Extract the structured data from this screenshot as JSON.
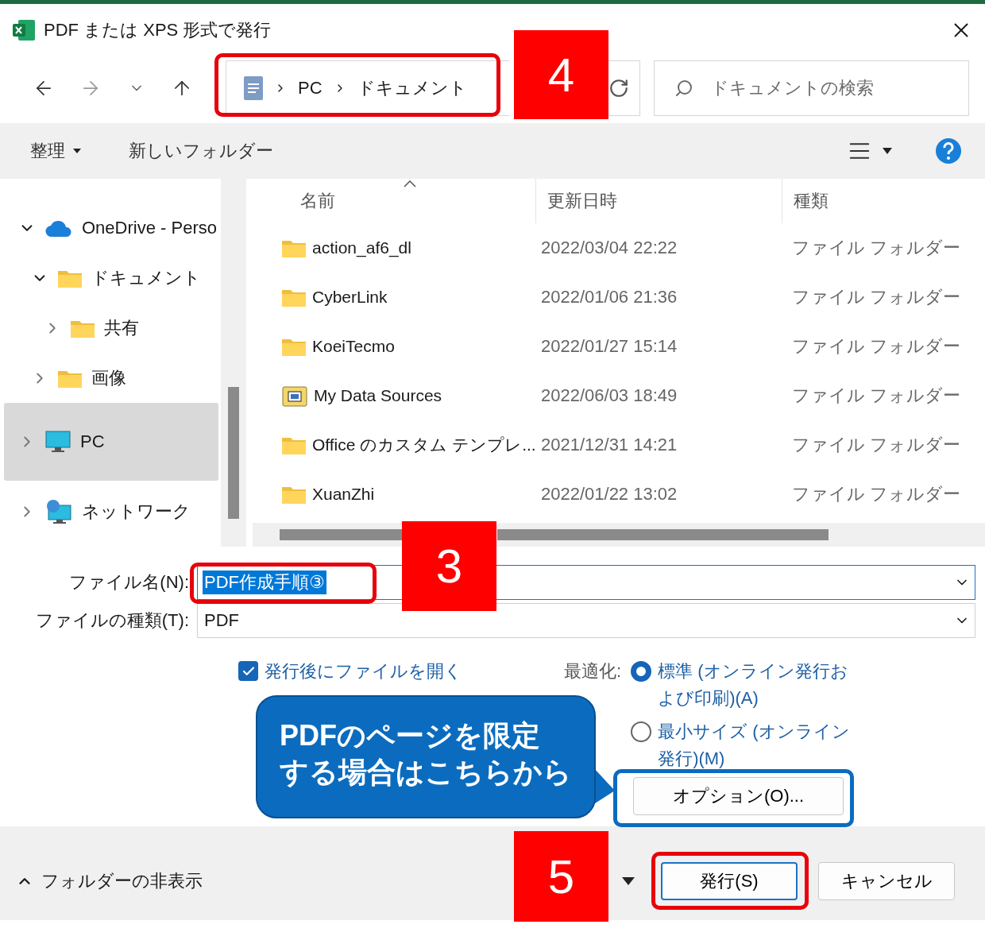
{
  "window": {
    "title": "PDF または XPS 形式で発行"
  },
  "nav": {
    "breadcrumb": [
      "PC",
      "ドキュメント"
    ],
    "search": {
      "placeholder": "ドキュメントの検索"
    }
  },
  "toolbar": {
    "organize": "整理",
    "new_folder": "新しいフォルダー"
  },
  "sidebar": {
    "items": [
      {
        "label": "OneDrive - Perso",
        "kind": "cloud",
        "expanded": true,
        "selected": false,
        "children": [
          {
            "label": "ドキュメント",
            "kind": "folder",
            "expanded": true,
            "selected": false,
            "children": [
              {
                "label": "共有",
                "kind": "folder",
                "expanded": false,
                "selected": false
              }
            ]
          },
          {
            "label": "画像",
            "kind": "folder",
            "expanded": false,
            "selected": false
          }
        ]
      },
      {
        "label": "PC",
        "kind": "pc",
        "expanded": false,
        "selected": true
      },
      {
        "label": "ネットワーク",
        "kind": "network",
        "expanded": false,
        "selected": false
      }
    ]
  },
  "table": {
    "columns": [
      {
        "label": "名前",
        "sorted": true
      },
      {
        "label": "更新日時",
        "sorted": false
      },
      {
        "label": "種類",
        "sorted": false
      }
    ],
    "rows": [
      {
        "name": "action_af6_dl",
        "kind": "folder",
        "date": "2022/03/04 22:22",
        "type": "ファイル フォルダー"
      },
      {
        "name": "CyberLink",
        "kind": "folder",
        "date": "2022/01/06 21:36",
        "type": "ファイル フォルダー"
      },
      {
        "name": "KoeiTecmo",
        "kind": "folder",
        "date": "2022/01/27 15:14",
        "type": "ファイル フォルダー"
      },
      {
        "name": "My Data Sources",
        "kind": "datasource",
        "date": "2022/06/03 18:49",
        "type": "ファイル フォルダー"
      },
      {
        "name": "Office のカスタム テンプレ...",
        "kind": "folder",
        "date": "2021/12/31 14:21",
        "type": "ファイル フォルダー"
      },
      {
        "name": "XuanZhi",
        "kind": "folder",
        "date": "2022/01/22 13:02",
        "type": "ファイル フォルダー"
      }
    ]
  },
  "form": {
    "file_name": {
      "label": "ファイル名(N):",
      "value": "PDF作成手順③"
    },
    "file_type": {
      "label": "ファイルの種類(T):",
      "value": "PDF"
    },
    "open_after": {
      "label": "発行後にファイルを開く",
      "checked": true
    },
    "optimize": {
      "label": "最適化:",
      "options": [
        {
          "label": "標準 (オンライン発行および印刷)(A)",
          "selected": true
        },
        {
          "label": "最小サイズ (オンライン発行)(M)",
          "selected": false
        }
      ]
    },
    "options_button": "オプション(O)..."
  },
  "footer": {
    "hide_folders": "フォルダーの非表示",
    "publish": "発行(S)",
    "cancel": "キャンセル"
  },
  "annotations": {
    "steps": [
      "4",
      "3",
      "5"
    ],
    "callout": [
      "PDFのページを限定",
      "する場合はこちらから"
    ]
  }
}
